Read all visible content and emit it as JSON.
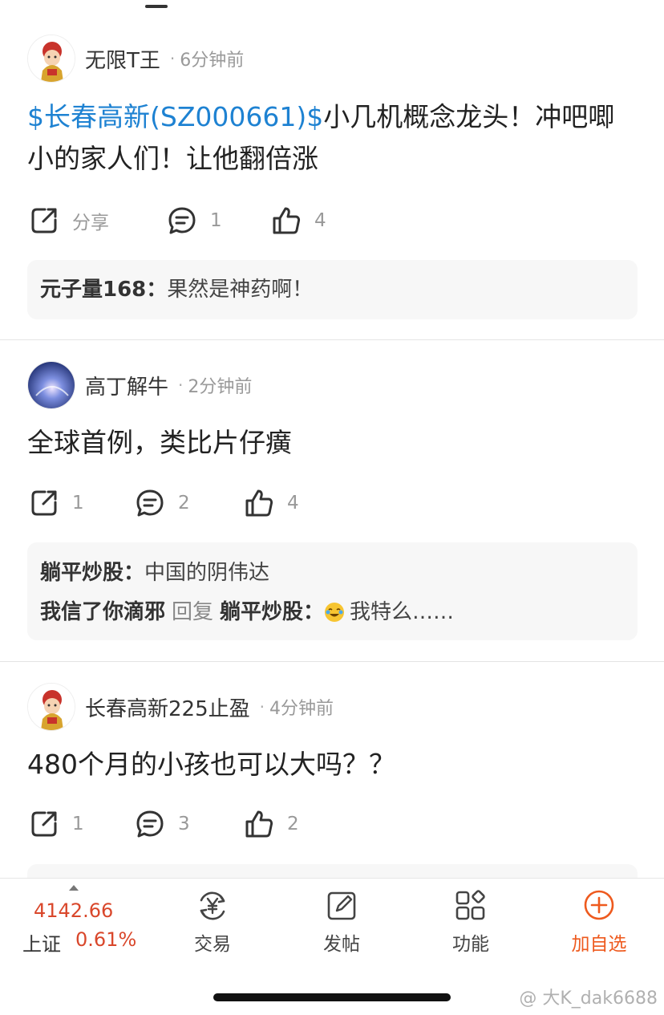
{
  "posts": [
    {
      "username": "无限T王",
      "time": "6分钟前",
      "stock_link": "$长春高新(SZ000661)$",
      "body": "小几机概念龙头！冲吧唧小的家人们！让他翻倍涨",
      "share_label": "分享",
      "comments_count": "1",
      "likes_count": "4",
      "comments": [
        {
          "author": "元子量168：",
          "text": "果然是神药啊！"
        }
      ]
    },
    {
      "username": "高丁解牛",
      "time": "2分钟前",
      "body": "全球首例，类比片仔癀",
      "share_count": "1",
      "comments_count": "2",
      "likes_count": "4",
      "comments": [
        {
          "author": "躺平炒股：",
          "text": "中国的阴伟达"
        },
        {
          "author": "我信了你滴邪",
          "reply_word": "回复",
          "reply_to": "躺平炒股：",
          "text": "我特么……"
        }
      ]
    },
    {
      "username": "长春高新225止盈",
      "time": "4分钟前",
      "body": "480个月的小孩也可以大吗？？",
      "share_count": "1",
      "comments_count": "3",
      "likes_count": "2"
    }
  ],
  "bottom_bar": {
    "index_value": "4142.66",
    "index_name": "上证",
    "index_change": "0.61%",
    "tabs": [
      {
        "label": "交易",
        "icon": "yen-exchange-icon"
      },
      {
        "label": "发帖",
        "icon": "edit-post-icon"
      },
      {
        "label": "功能",
        "icon": "apps-grid-icon"
      },
      {
        "label": "加自选",
        "icon": "add-circle-icon"
      }
    ]
  },
  "watermark": "@ 大K_dak6688",
  "colors": {
    "link": "#1e82d2",
    "accent": "#ee5a1e",
    "rise": "#d9472b"
  }
}
